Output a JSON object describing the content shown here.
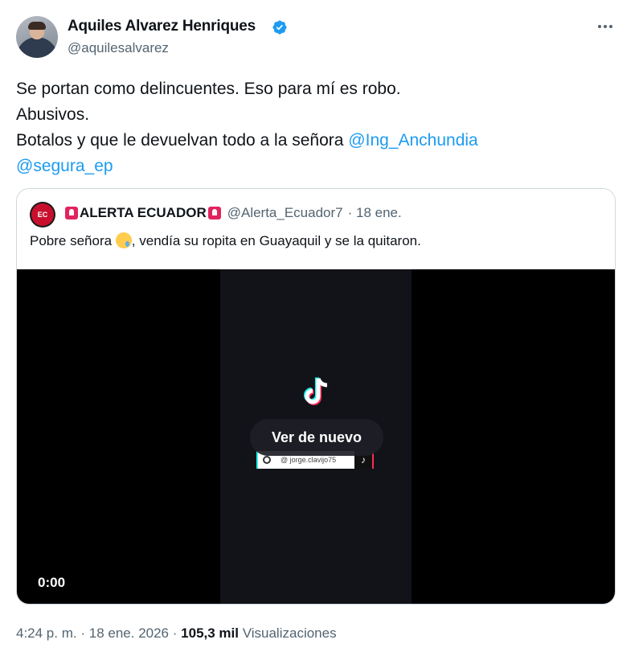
{
  "author": {
    "name": "Aquiles Alvarez Henriques",
    "handle": "@aquilesalvarez",
    "verified": true,
    "avatar_icon": "avatar-photo"
  },
  "more_icon": "more-options-icon",
  "tweet": {
    "lines": [
      "Se portan como delincuentes. Eso para mí es robo.",
      "Abusivos.",
      "Botalos y que le devuelvan todo a la señora "
    ],
    "mention1": "@Ing_Anchundia",
    "mention2": "@segura_ep"
  },
  "quote": {
    "name": "ALERTA ECUADOR",
    "avatar_label": "EC",
    "handle": "@Alerta_Ecuador7",
    "date": "· 18 ene.",
    "text_before": "Pobre señora ",
    "text_after": ", vendía su ropita en Guayaquil y se la quitaron.",
    "emoji": "crying-face",
    "video": {
      "replay_label": "Ver de nuevo",
      "time": "0:00",
      "search_text": "@ jorge.clavijo75",
      "tiktok_glyph": "♪"
    }
  },
  "footer": {
    "time": "4:24 p. m.",
    "date": "18 ene. 2026",
    "views": "105,3 mil",
    "views_label": "Visualizaciones",
    "separator": "·"
  },
  "colors": {
    "link": "#1d9bf0",
    "secondary_text": "#536471",
    "verified": "#1d9bf0"
  }
}
